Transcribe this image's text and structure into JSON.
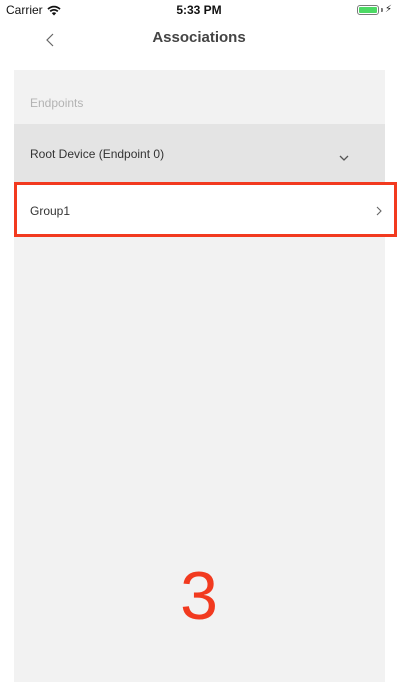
{
  "status_bar": {
    "carrier": "Carrier",
    "time": "5:33 PM",
    "battery_level": 1.0
  },
  "nav": {
    "title": "Associations",
    "back_icon": "chevron-left-icon"
  },
  "section": {
    "header": "Endpoints"
  },
  "endpoint": {
    "selected": "Root Device (Endpoint 0)",
    "chevron_icon": "chevron-down-icon"
  },
  "groups": [
    {
      "label": "Group1",
      "chevron_icon": "chevron-right-icon"
    }
  ],
  "annotation": {
    "step": "3",
    "color": "#f23a1f"
  },
  "colors": {
    "section_bg": "#f2f2f2",
    "endpoint_row_bg": "#e4e4e4",
    "battery": "#4cd964"
  }
}
